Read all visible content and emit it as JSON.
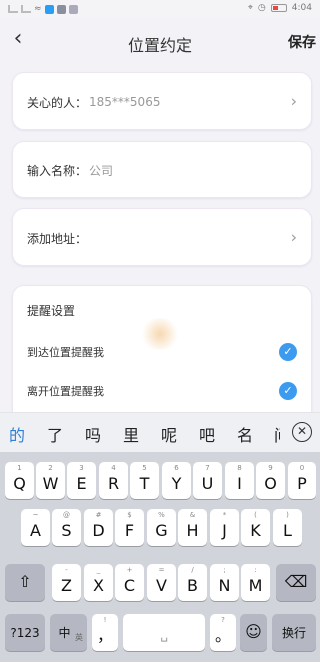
{
  "status": {
    "time": "4:04"
  },
  "nav": {
    "back_glyph": "‹",
    "title": "位置约定",
    "save_label": "保存"
  },
  "form": {
    "contact": {
      "label": "关心的人：",
      "value": "185***5065"
    },
    "name": {
      "label": "输入名称：",
      "value": "公司"
    },
    "address": {
      "label": "添加地址：",
      "value": ""
    }
  },
  "reminder": {
    "title": "提醒设置",
    "arrive_label": "到达位置提醒我",
    "leave_label": "离开位置提醒我"
  },
  "candidates": [
    "的",
    "了",
    "吗",
    "里",
    "呢",
    "吧",
    "名",
    "间"
  ],
  "keyboard": {
    "row1": [
      {
        "hint": "1",
        "ch": "Q"
      },
      {
        "hint": "2",
        "ch": "W"
      },
      {
        "hint": "3",
        "ch": "E"
      },
      {
        "hint": "4",
        "ch": "R"
      },
      {
        "hint": "5",
        "ch": "T"
      },
      {
        "hint": "6",
        "ch": "Y"
      },
      {
        "hint": "7",
        "ch": "U"
      },
      {
        "hint": "8",
        "ch": "I"
      },
      {
        "hint": "9",
        "ch": "O"
      },
      {
        "hint": "0",
        "ch": "P"
      }
    ],
    "row2": [
      {
        "hint": "~",
        "ch": "A"
      },
      {
        "hint": "@",
        "ch": "S"
      },
      {
        "hint": "#",
        "ch": "D"
      },
      {
        "hint": "$",
        "ch": "F"
      },
      {
        "hint": "%",
        "ch": "G"
      },
      {
        "hint": "&",
        "ch": "H"
      },
      {
        "hint": "*",
        "ch": "J"
      },
      {
        "hint": "(",
        "ch": "K"
      },
      {
        "hint": ")",
        "ch": "L"
      }
    ],
    "row3": [
      {
        "hint": "-",
        "ch": "Z"
      },
      {
        "hint": "_",
        "ch": "X"
      },
      {
        "hint": "+",
        "ch": "C"
      },
      {
        "hint": "=",
        "ch": "V"
      },
      {
        "hint": "/",
        "ch": "B"
      },
      {
        "hint": ";",
        "ch": "N"
      },
      {
        "hint": ":",
        "ch": "M"
      }
    ],
    "shift_glyph": "⇧",
    "delete_glyph": "⌫",
    "symbols_label": "?123",
    "lang_label": "中",
    "lang_sub": "英",
    "comma_label": "，",
    "comma_hint": "!",
    "space_label": "␣",
    "period_label": "。",
    "period_hint": "?",
    "emoji_glyph": "☺",
    "enter_label": "换行"
  }
}
